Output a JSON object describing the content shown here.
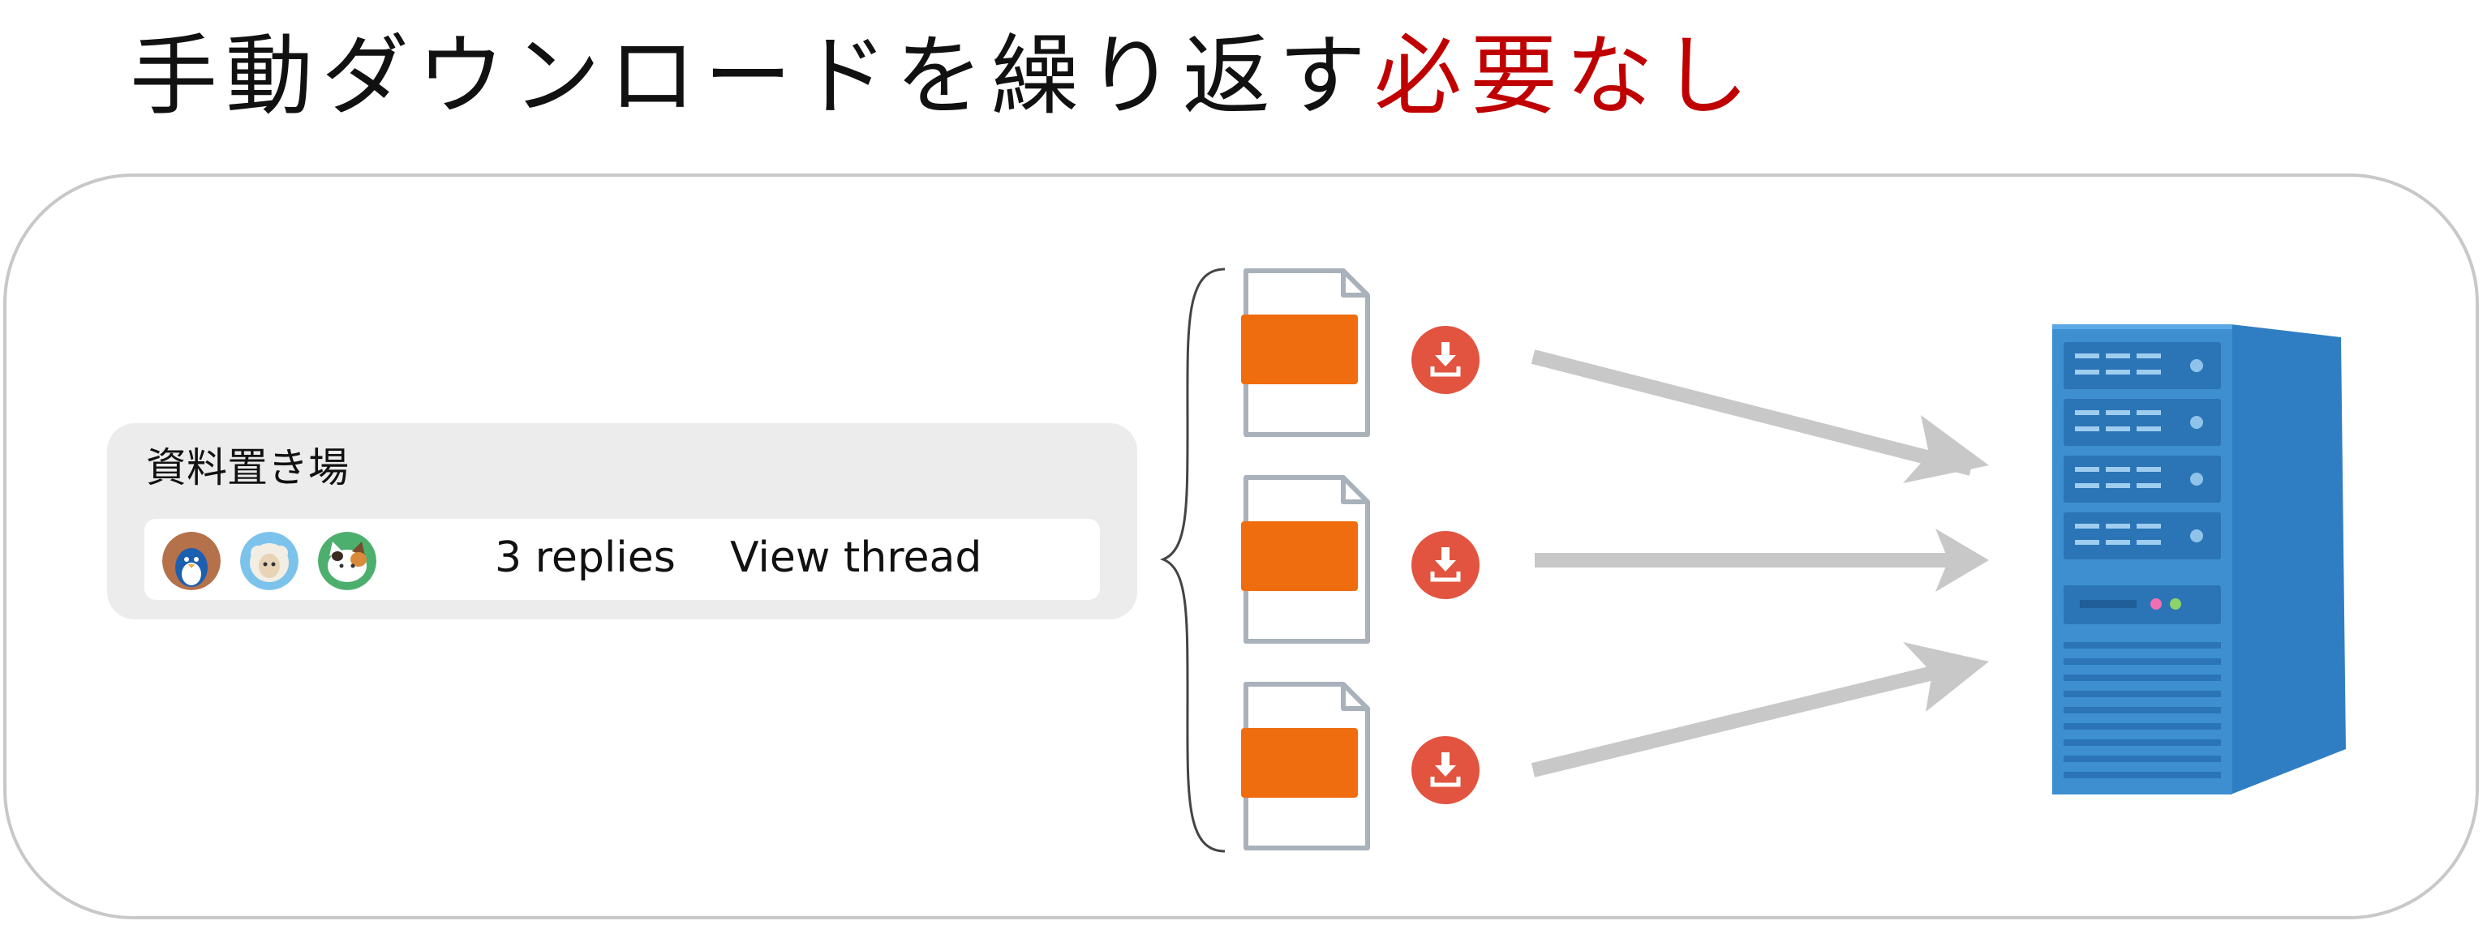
{
  "title": {
    "main": "手動ダウンロードを繰り返す",
    "accent": "必要なし"
  },
  "thread": {
    "channel": "資料置き場",
    "avatars": [
      "penguin-avatar",
      "sheep-avatar",
      "calico-cat-avatar"
    ],
    "replies": "3 replies",
    "view_thread": "View thread"
  },
  "files": [
    {
      "icon": "document-icon",
      "action": "download-icon"
    },
    {
      "icon": "document-icon",
      "action": "download-icon"
    },
    {
      "icon": "document-icon",
      "action": "download-icon"
    }
  ],
  "target": {
    "icon": "server-tower-icon"
  },
  "colors": {
    "accent": "#c00000",
    "file_label": "#ef6c0f",
    "download": "#e2543f",
    "arrow": "#c8c8c8",
    "server": "#3d8fd0",
    "card": "#ececec"
  }
}
